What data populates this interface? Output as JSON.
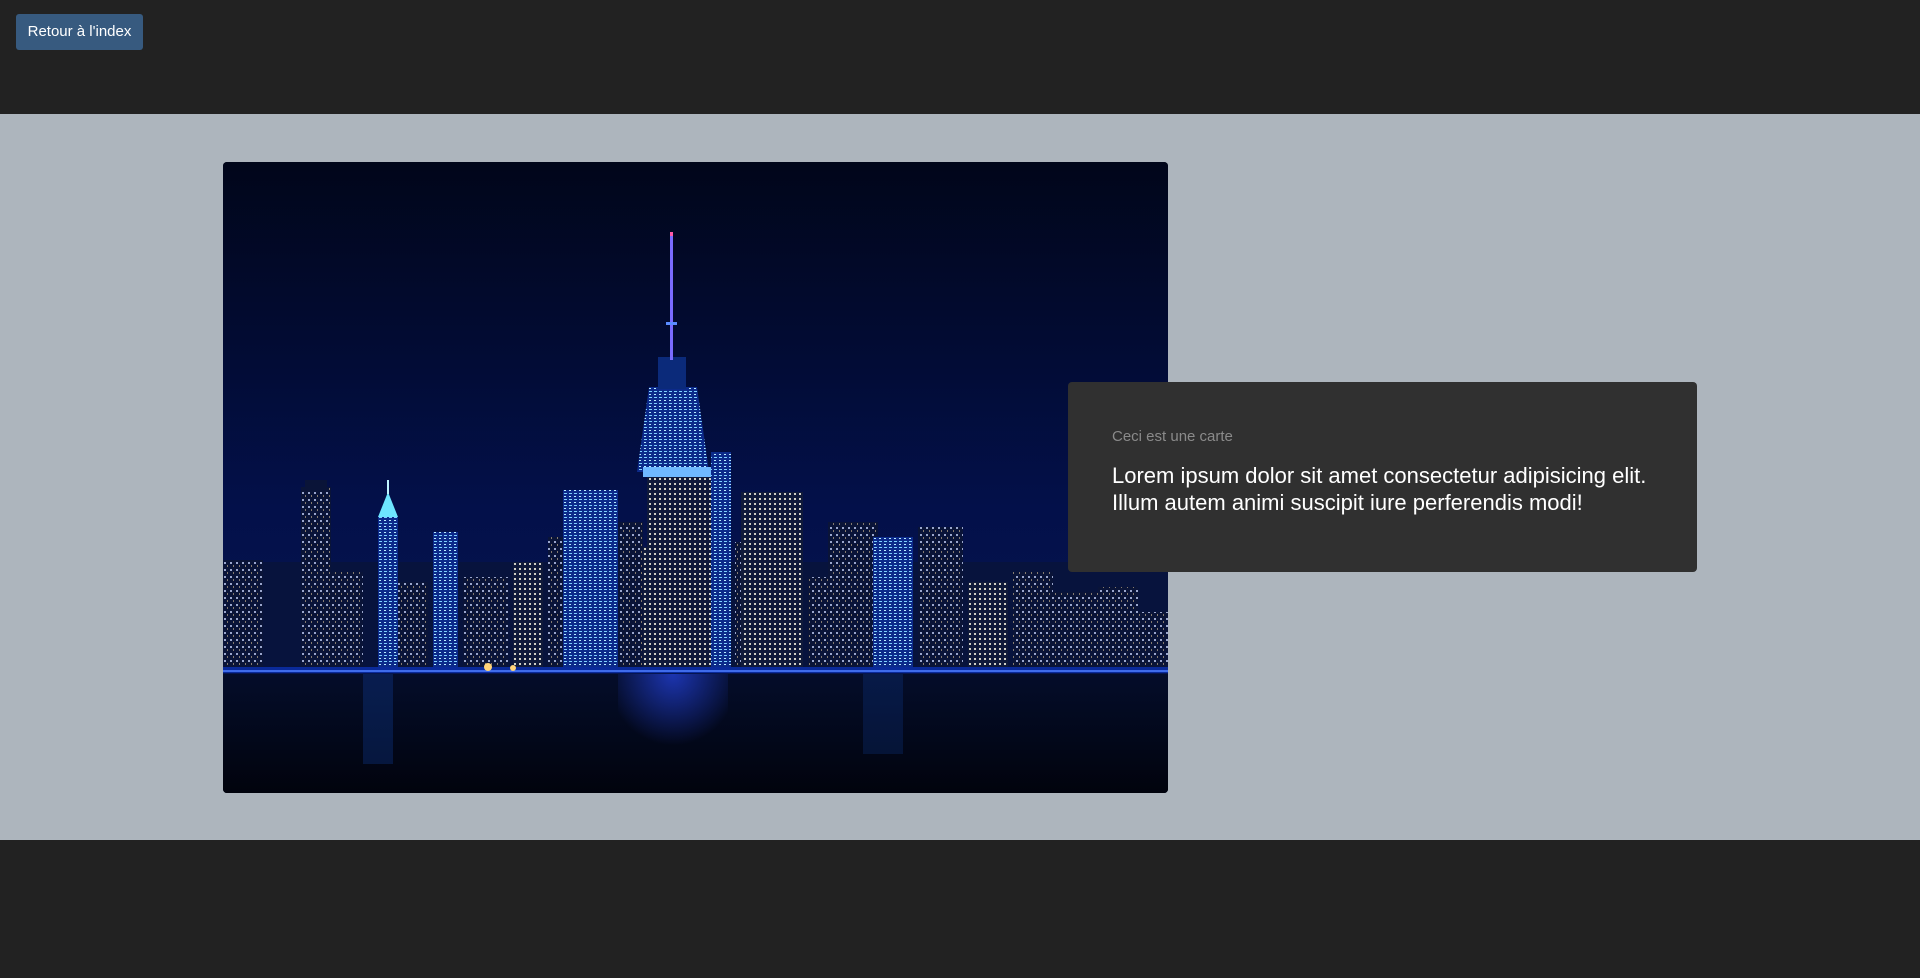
{
  "header": {
    "back_button_label": "Retour à l'index"
  },
  "hero": {
    "image_icon": "city-skyline-night-photo"
  },
  "card": {
    "subtitle": "Ceci est une carte",
    "text": "Lorem ipsum dolor sit amet consectetur adipisicing elit. Illum autem animi suscipit iure perferendis modi!"
  },
  "colors": {
    "page_background": "#222222",
    "section_background": "#adb5bd",
    "card_background": "#303030",
    "button_background": "#375a7f"
  }
}
